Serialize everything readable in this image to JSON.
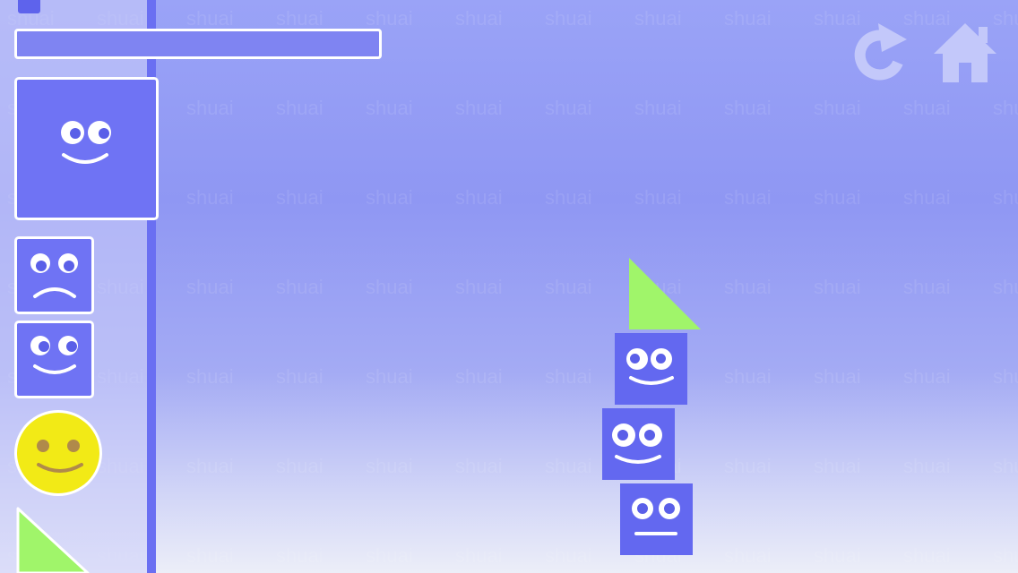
{
  "watermark_text": "shuai",
  "colors": {
    "block": "#6368f0",
    "triangle": "#a0f56a",
    "circle": "#f2ea16",
    "sidebar_edge": "#6a6ff2"
  },
  "toolbar": {
    "restart_icon": "restart-icon",
    "home_icon": "home-icon"
  },
  "progress_level": 0,
  "sidebar_pieces": [
    {
      "shape": "square-large",
      "expression": "smile"
    },
    {
      "shape": "square-small",
      "expression": "sad"
    },
    {
      "shape": "square-small",
      "expression": "smile"
    },
    {
      "shape": "circle",
      "expression": "smile"
    },
    {
      "shape": "triangle",
      "expression": "none"
    }
  ],
  "tower": [
    {
      "shape": "triangle",
      "expression": "none"
    },
    {
      "shape": "square",
      "expression": "smile"
    },
    {
      "shape": "square",
      "expression": "smile"
    },
    {
      "shape": "square",
      "expression": "neutral"
    }
  ]
}
